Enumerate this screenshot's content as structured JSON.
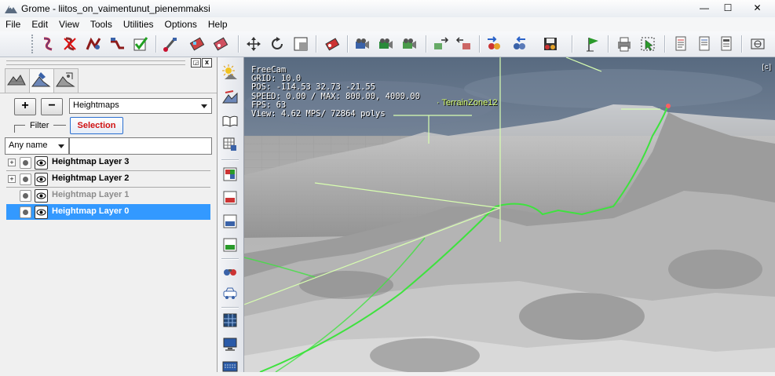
{
  "window": {
    "title": "Grome - liitos_on_vaimentunut_pienemmaksi",
    "minimize_glyph": "—",
    "maximize_glyph": "☐",
    "close_glyph": "✕"
  },
  "menu": [
    {
      "label": "File"
    },
    {
      "label": "Edit"
    },
    {
      "label": "View"
    },
    {
      "label": "Tools"
    },
    {
      "label": "Utilities"
    },
    {
      "label": "Options"
    },
    {
      "label": "Help"
    }
  ],
  "toolbar_icons": [
    "sculpt-brush-icon",
    "erase-brush-icon",
    "smooth-brush-icon",
    "flatten-brush-icon",
    "apply-brush-icon",
    "paint-brush-icon",
    "texture-brush-icon",
    "detail-brush-icon",
    "move-icon",
    "rotate-icon",
    "scale-icon",
    "object-tool-icon",
    "camera-a-icon",
    "camera-b-icon",
    "camera-c-icon",
    "import-icon",
    "export-icon",
    "zone-in-icon",
    "zone-out-icon",
    "save-disk-icon",
    "flag-icon",
    "print-icon",
    "select-icon",
    "doc-a-icon",
    "doc-b-icon",
    "doc-c-icon",
    "fullscreen-icon"
  ],
  "left_panel": {
    "pin_glyph": "◲",
    "close_glyph": "x",
    "tabs": [
      "terrain-tab-icon",
      "paint-tab-icon",
      "objects-tab-icon"
    ],
    "add_layer_glyph": "+",
    "remove_layer_glyph": "−",
    "layer_type": "Heightmaps",
    "filter_label": "Filter",
    "selection_label": "Selection",
    "name_filter": "Any name",
    "search_value": "",
    "layers": [
      {
        "name": "Heightmap Layer 3",
        "expandable": true,
        "state": "normal"
      },
      {
        "name": "Heightmap Layer 2",
        "expandable": true,
        "state": "normal"
      },
      {
        "name": "Heightmap Layer 1",
        "expandable": false,
        "state": "dim"
      },
      {
        "name": "Heightmap Layer 0",
        "expandable": false,
        "state": "selected"
      }
    ]
  },
  "vertical_toolbar_icons": [
    "sun-light-icon",
    "heightmap-tool-icon",
    "open-book-icon",
    "grid-tool-icon",
    "colors-a-icon",
    "colors-b-icon",
    "colors-c-icon",
    "colors-d-icon",
    "search-binoculars-icon",
    "vehicle-icon",
    "window-grid-icon",
    "monitor-icon",
    "keyboard-icon"
  ],
  "viewport": {
    "hud": [
      "FreeCam",
      "GRID: 10.0",
      "POS: -114.53 32.73 -21.55",
      "SPEED: 0.00 / MAX: 800.00, 4000.00",
      "FPS: 63",
      "View: 4.62 MPS/ 72864 polys"
    ],
    "zone_label": "· TerrainZone12",
    "corner_label": "[c]",
    "colors": {
      "sky_top": "#5e6e84",
      "sky_low": "#c9d1db",
      "terrain_light": "#dcdcdc",
      "terrain_dark": "#6d6d6d",
      "spline": "#3ee23e",
      "gizmo": "#d8ffb0"
    }
  }
}
